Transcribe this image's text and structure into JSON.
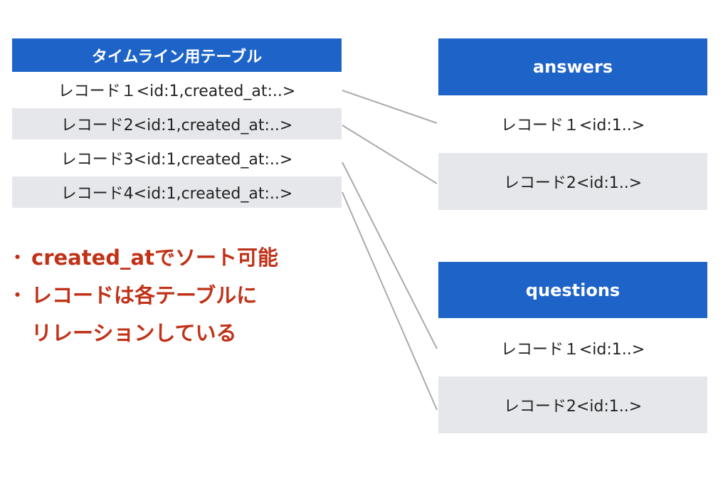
{
  "timeline_table": {
    "title": "タイムライン用テーブル",
    "rows": [
      "レコード１<id:1,created_at:..>",
      "レコード2<id:1,created_at:..>",
      "レコード3<id:1,created_at:..>",
      "レコード4<id:1,created_at:..>"
    ]
  },
  "answers_table": {
    "title": "answers",
    "rows": [
      "レコード１<id:1..>",
      "レコード2<id:1..>"
    ]
  },
  "questions_table": {
    "title": "questions",
    "rows": [
      "レコード１<id:1..>",
      "レコード2<id:1..>"
    ]
  },
  "notes": {
    "bullet": "・",
    "items": [
      "created_atでソート可能",
      "レコードは各テーブルに",
      "リレーションしている"
    ]
  },
  "colors": {
    "header_blue": "#1e64c8",
    "row_gray": "#e6e7eb",
    "note_red": "#c03218",
    "connector_gray": "#aaaaaa"
  }
}
